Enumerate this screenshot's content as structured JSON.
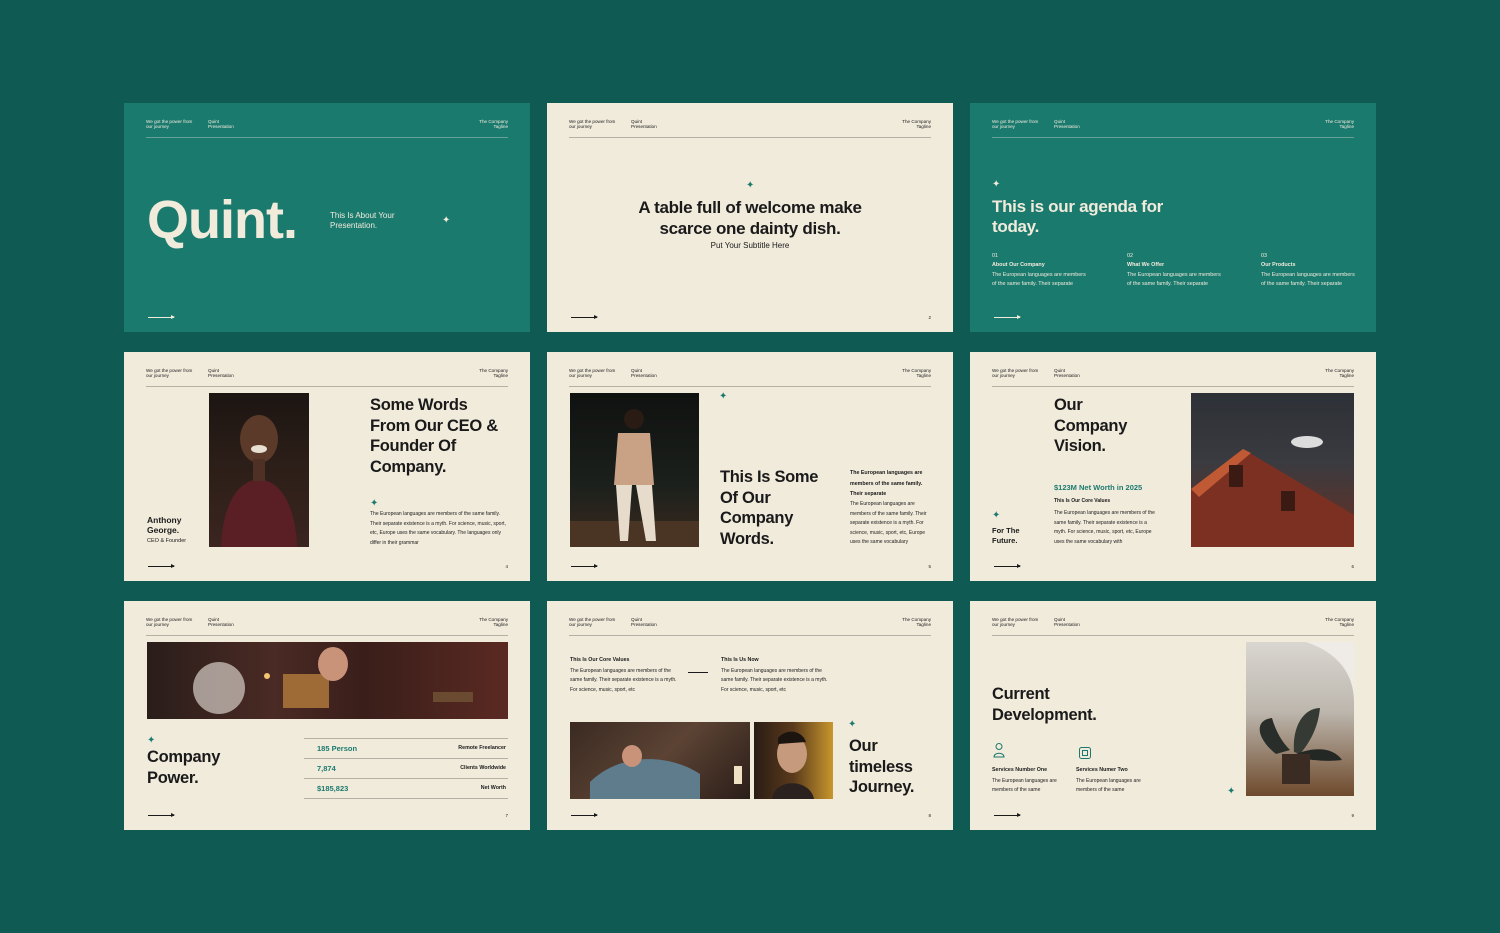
{
  "header": {
    "left": "We got the power from our journey",
    "middle": "Quint Presentation",
    "right": "The Company Tagline"
  },
  "slides": {
    "s1": {
      "title": "Quint.",
      "subtitle": "This Is About Your Presentation."
    },
    "s2": {
      "title": "A table full of welcome make scarce one dainty dish.",
      "subtitle": "Put Your Subtitle Here",
      "page": "2"
    },
    "s3": {
      "title": "This is our agenda for today.",
      "items": [
        {
          "num": "01",
          "label": "About Our Company",
          "text": "The European languages are members of the same family. Their separate"
        },
        {
          "num": "02",
          "label": "What We Offer",
          "text": "The European languages are members of the same family. Their separate"
        },
        {
          "num": "03",
          "label": "Our Products",
          "text": "The European languages are members of the same family. Their separate"
        }
      ]
    },
    "s4": {
      "title": "Some Words From Our CEO & Founder Of Company.",
      "name": "Anthony George.",
      "role": "CEO & Founder",
      "text": "The European languages are members of the same family. Their separate existence is a myth. For science, music, sport, etc, Europe uses the same vocabulary. The languages only differ in their grammar",
      "page": "4"
    },
    "s5": {
      "title": "This Is Some Of Our Company Words.",
      "lead": "The European languages are members of the same family. Their separate",
      "text": "The European languages are members of the same family. Their separate existence is a myth. For science, music, sport, etc, Europe uses the same vocabulary",
      "page": "5"
    },
    "s6": {
      "title": "Our Company Vision.",
      "side": "For The Future.",
      "highlight": "$123M Net Worth in 2025",
      "label": "This Is Our Core Values",
      "text": "The European languages are members of the same family. Their separate existence is a myth. For science, music, sport, etc, Europe uses the same vocabulary with",
      "page": "6"
    },
    "s7": {
      "title": "Company Power.",
      "rows": [
        {
          "value": "185 Person",
          "label": "Remote Freelancer"
        },
        {
          "value": "7,874",
          "label": "Clients Worldwide"
        },
        {
          "value": "$185,823",
          "label": "Net Worth"
        }
      ],
      "page": "7"
    },
    "s8": {
      "title": "Our timeless Journey.",
      "col1_label": "This Is Our Core Values",
      "col1_text": "The European languages are members of the same family. Their separate existence is a myth. For science, music, sport, etc",
      "col2_label": "This Is Us Now",
      "col2_text": "The European languages are members of the same family. Their separate existence is a myth. For science, music, sport, etc",
      "page": "8"
    },
    "s9": {
      "title": "Current Development.",
      "svc1_label": "Services Number One",
      "svc1_text": "The European languages are members of the same",
      "svc2_label": "Services Numer Two",
      "svc2_text": "The European languages are members of the same",
      "page": "9"
    }
  },
  "icons": [
    "sparkle-icon",
    "arrow-right-icon",
    "person-icon",
    "gear-box-icon"
  ],
  "colors": {
    "background": "#0f5a52",
    "teal": "#1b7a6e",
    "cream": "#f1ebdc",
    "ink": "#1a1a1a"
  }
}
